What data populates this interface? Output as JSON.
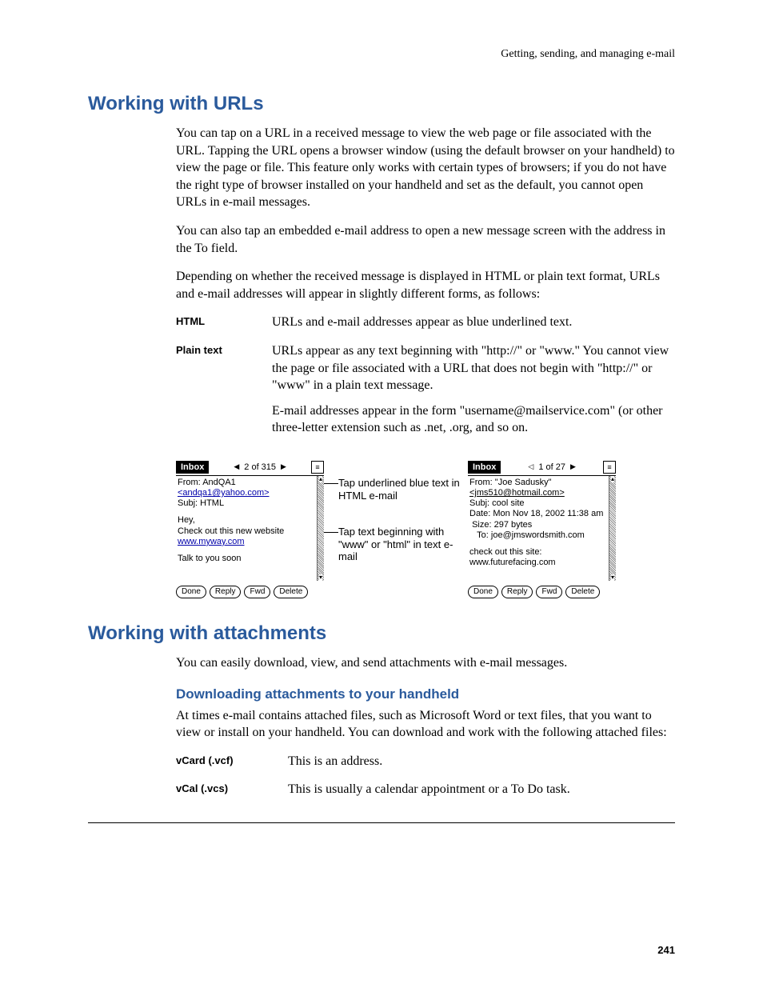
{
  "running_head": "Getting, sending, and managing e-mail",
  "page_number": "241",
  "section1": {
    "title": "Working with URLs",
    "para1": "You can tap on a URL in a received message to view the web page or file associated with the URL. Tapping the URL opens a browser window (using the default browser on your handheld) to view the page or file. This feature only works with certain types of browsers; if you do not have the right type of browser installed on your handheld and set as the default, you cannot open URLs in e-mail messages.",
    "para2": "You can also tap an embedded e-mail address to open a new message screen with the address in the To field.",
    "para3": "Depending on whether the received message is displayed in HTML or plain text format, URLs and e-mail addresses will appear in slightly different forms, as follows:",
    "def1": {
      "term": "HTML",
      "desc": "URLs and e-mail addresses appear as blue underlined text."
    },
    "def2": {
      "term": "Plain text",
      "desc_p1": "URLs appear as any text beginning with \"http://\" or \"www.\" You cannot view the page or file associated with a URL that does not begin with \"http://\" or \"www\" in a plain text message.",
      "desc_p2": "E-mail addresses appear in the form \"username@mailservice.com\" (or other three-letter extension such as .net, .org, and so on."
    }
  },
  "figure": {
    "left": {
      "title": "Inbox",
      "counter": "2 of 315",
      "from_label": "From:",
      "from_value": "AndQA1",
      "email_link": "<andqa1@yahoo.com>",
      "subj_label": "Subj:",
      "subj_value": "HTML",
      "body_line1": "Hey,",
      "body_line2": "Check out this new website",
      "body_link": "www.myway.com",
      "body_line3": "Talk to you soon",
      "buttons": {
        "done": "Done",
        "reply": "Reply",
        "fwd": "Fwd",
        "delete": "Delete"
      }
    },
    "callouts": {
      "c1": "Tap underlined blue text in HTML e-mail",
      "c2": "Tap text beginning with \"www\" or \"html\" in text e-mail"
    },
    "right": {
      "title": "Inbox",
      "counter": "1 of 27",
      "from_label": "From:",
      "from_value": "\"Joe Sadusky\"",
      "email_link": "<jms510@hotmail.com>",
      "subj_label": "Subj:",
      "subj_value": "cool site",
      "date_label": "Date:",
      "date_value": "Mon Nov 18, 2002 11:38 am",
      "size_label": "Size:",
      "size_value": "297 bytes",
      "to_label": "To:",
      "to_value": "joe@jmswordsmith.com",
      "body_line1": "check out this site:",
      "body_line2": "www.futurefacing.com",
      "buttons": {
        "done": "Done",
        "reply": "Reply",
        "fwd": "Fwd",
        "delete": "Delete"
      }
    }
  },
  "section2": {
    "title": "Working with attachments",
    "para1": "You can easily download, view, and send attachments with e-mail messages.",
    "sub1": {
      "title": "Downloading attachments to your handheld",
      "para1": "At times e-mail contains attached files, such as Microsoft Word or text files, that you want to view or install on your handheld. You can download and work with the following attached files:",
      "def1": {
        "term": "vCard (.vcf)",
        "desc": "This is an address."
      },
      "def2": {
        "term": "vCal (.vcs)",
        "desc": "This is usually a calendar appointment or a To Do task."
      }
    }
  }
}
